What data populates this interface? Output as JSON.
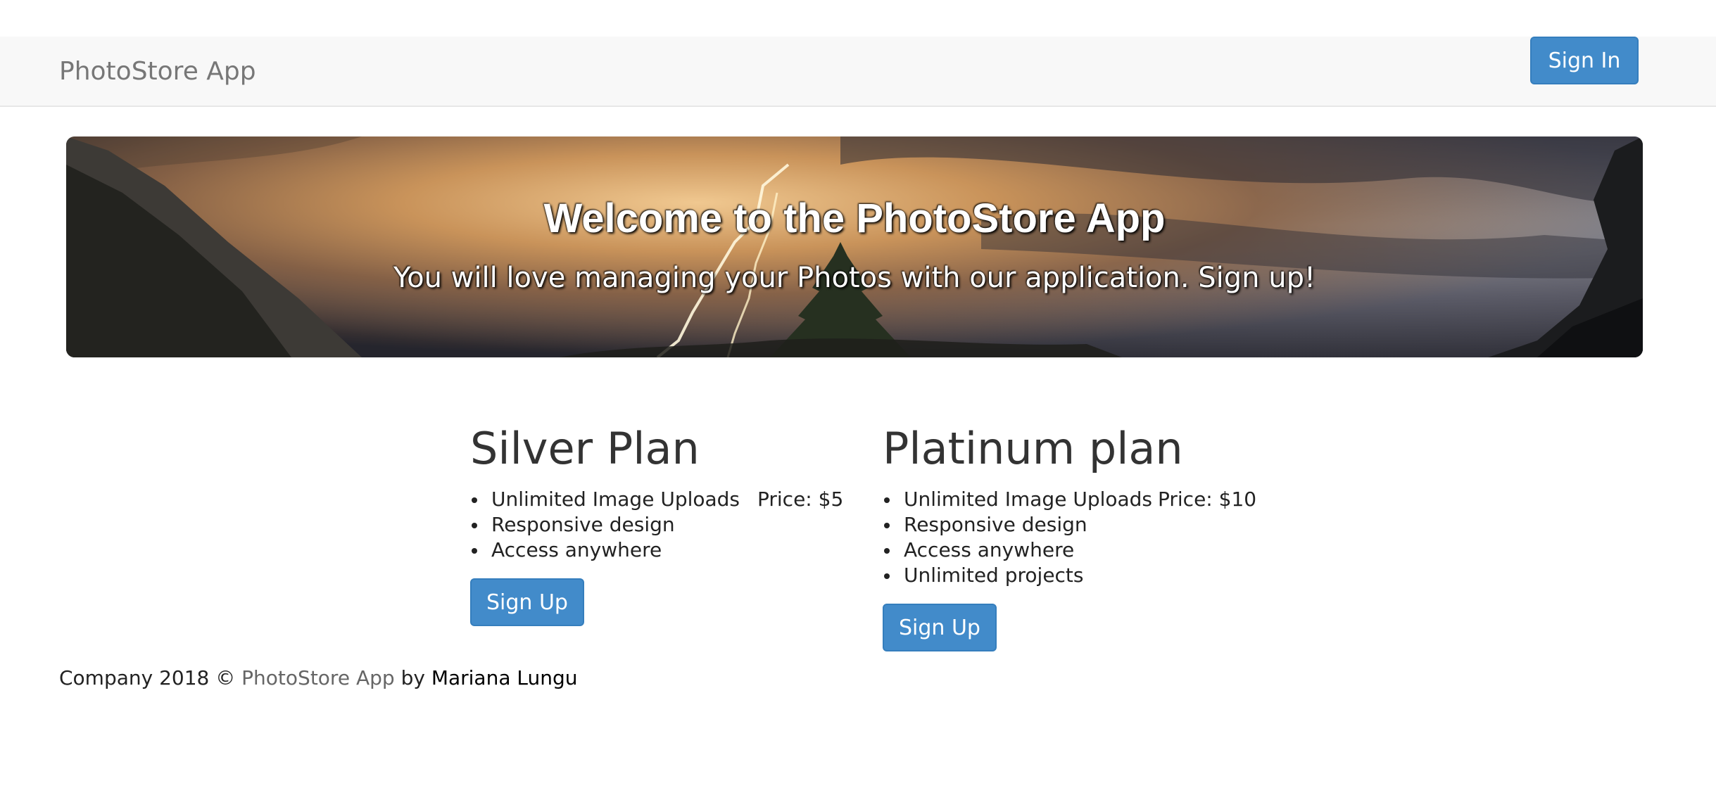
{
  "navbar": {
    "brand": "PhotoStore App",
    "signin_label": "Sign In"
  },
  "hero": {
    "title": "Welcome to the PhotoStore App",
    "subtitle": "You will love managing your Photos with our application. Sign up!"
  },
  "plans": [
    {
      "title": "Silver Plan",
      "features": [
        "Unlimited Image Uploads",
        "Responsive design",
        "Access anywhere"
      ],
      "price": "Price: $5",
      "button_label": "Sign Up"
    },
    {
      "title": "Platinum plan",
      "features": [
        "Unlimited Image Uploads",
        "Responsive design",
        "Access anywhere",
        "Unlimited projects"
      ],
      "price": "Price: $10",
      "button_label": "Sign Up"
    }
  ],
  "footer": {
    "prefix": "Company 2018 ©",
    "app_link": "PhotoStore App",
    "by": "by",
    "author": "Mariana Lungu"
  },
  "colors": {
    "primary": "#428bca",
    "navbar_bg": "#f8f8f8",
    "brand_text": "#777777"
  },
  "icons": {
    "hero_background": "storm-landscape-image"
  }
}
